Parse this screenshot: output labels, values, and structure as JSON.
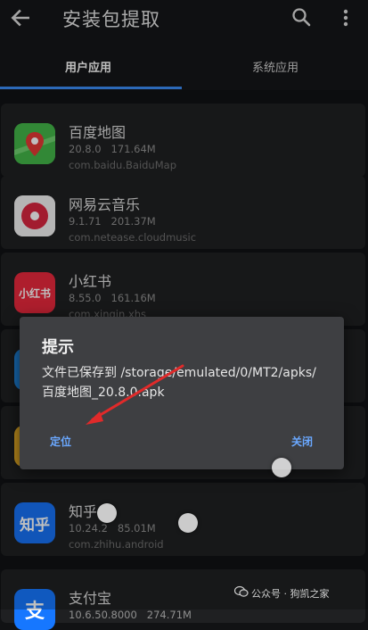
{
  "topbar": {
    "title": "安装包提取",
    "back_icon": "arrow-left-icon",
    "search_icon": "search-icon",
    "more_icon": "more-vertical-icon"
  },
  "tabs": [
    {
      "label": "用户应用",
      "selected": true
    },
    {
      "label": "系统应用",
      "selected": false
    }
  ],
  "apps": [
    {
      "name": "百度地图",
      "version": "20.8.0",
      "size": "171.64M",
      "package": "com.baidu.BaiduMap",
      "icon": "baidu-map-icon"
    },
    {
      "name": "网易云音乐",
      "version": "9.1.71",
      "size": "201.37M",
      "package": "com.netease.cloudmusic",
      "icon": "netease-music-icon"
    },
    {
      "name": "小红书",
      "version": "8.55.0",
      "size": "161.16M",
      "package": "com.xingin.xhs",
      "icon_text": "小红书",
      "icon": "xiaohongshu-icon"
    },
    {
      "name": "知乎",
      "version": "10.24.2",
      "size": "85.01M",
      "package": "com.zhihu.android",
      "icon_text": "知乎",
      "icon": "zhihu-icon"
    },
    {
      "name": "支付宝",
      "version": "10.6.50.8000",
      "size": "274.71M",
      "icon_text": "支",
      "icon": "alipay-icon"
    }
  ],
  "dialog": {
    "title": "提示",
    "message": "文件已保存到 /storage/emulated/0/MT2/apks/百度地图_20.8.0.apk",
    "locate_label": "定位",
    "close_label": "关闭"
  },
  "watermark": {
    "text": "公众号 · 狗凯之家",
    "icon": "wechat-icon"
  },
  "colors": {
    "accent": "#3b8cf6",
    "dialog_button": "#6aa8ff",
    "annotation_arrow": "#e02a2a"
  }
}
